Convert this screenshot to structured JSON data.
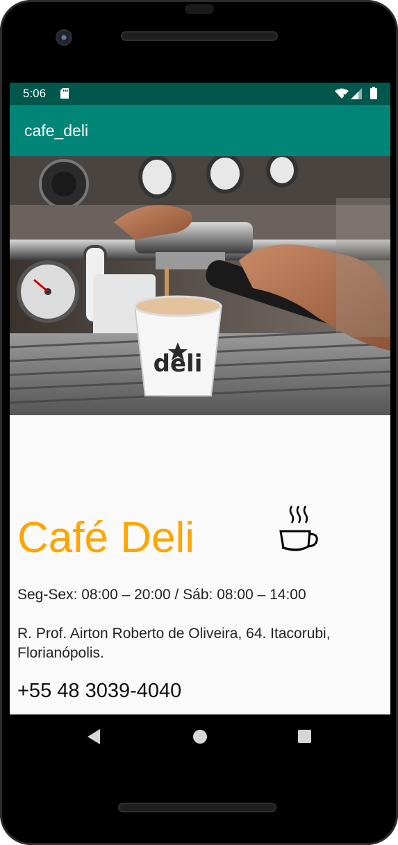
{
  "status_bar": {
    "time": "5:06",
    "icons": [
      "sd-card-icon",
      "wifi-icon",
      "signal-icon",
      "battery-icon"
    ],
    "color": "#00574b"
  },
  "app_bar": {
    "title": "cafe_deli",
    "color": "#008577"
  },
  "hero_image": {
    "description_icon": "espresso-machine-photo",
    "cup_print": "deli"
  },
  "content": {
    "title": "Café Deli",
    "title_color": "#ffa500",
    "title_icon": "coffee-cup-icon",
    "hours": "Seg-Sex: 08:00 – 20:00 / Sáb: 08:00 – 14:00",
    "address": "R. Prof. Airton Roberto de Oliveira, 64. Itacorubi, Florianópolis.",
    "phone": "+55 48 3039-4040"
  },
  "nav_bar": {
    "buttons": [
      "back-icon",
      "home-icon",
      "recents-icon"
    ]
  }
}
